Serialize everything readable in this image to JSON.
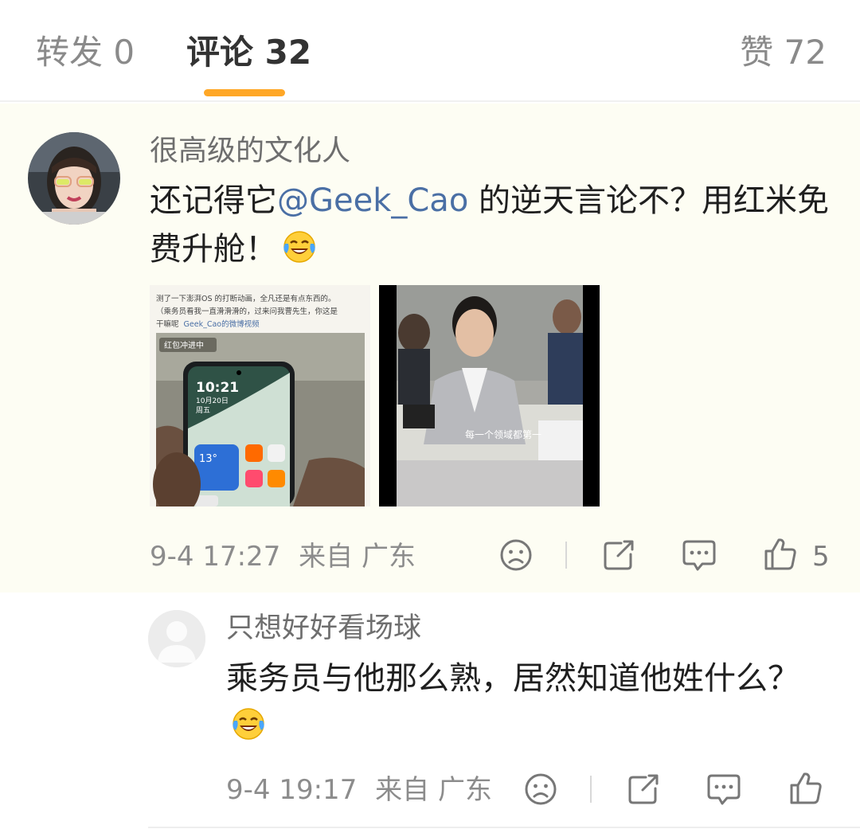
{
  "tabs": {
    "repost": "转发 0",
    "comment": "评论 32",
    "like": "赞 72"
  },
  "comment": {
    "username": "很高级的文化人",
    "text_before": "还记得它",
    "mention": "@Geek_Cao",
    "text_after": " 的逆天言论不？用红米免费升舱！",
    "emoji": "laughing-crying-emoji",
    "images": {
      "phone_caption_line1": "测了一下澎湃OS 的打断动画，全凡还是有点东西的。",
      "phone_caption_line2": "（乘务员看我一直滑滑滑的，过来问我曹先生，你这是",
      "phone_caption_line3": "干嘛呢",
      "phone_caption_link": "Geek_Cao的微博视频",
      "phone_badge": "红包冲进中",
      "phone_time": "10:21",
      "phone_date": "10月20日",
      "phone_weekday": "周五",
      "phone_weather": "13°",
      "video_subtitle": "每一个领域都第一"
    },
    "time": "9-4 17:27",
    "location": "来自 广东",
    "like_count": "5"
  },
  "reply": {
    "username": "只想好好看场球",
    "text": "乘务员与他那么熟，居然知道他姓什么？",
    "emoji": "laughing-crying-emoji",
    "time": "9-4 19:17",
    "location": "来自 广东"
  },
  "colors": {
    "accent": "#ffa726",
    "mention": "#4a6fa5",
    "highlight_bg": "#fdfdf3"
  },
  "icons": [
    "sad-face-icon",
    "share-icon",
    "comment-icon",
    "thumbs-up-icon"
  ]
}
